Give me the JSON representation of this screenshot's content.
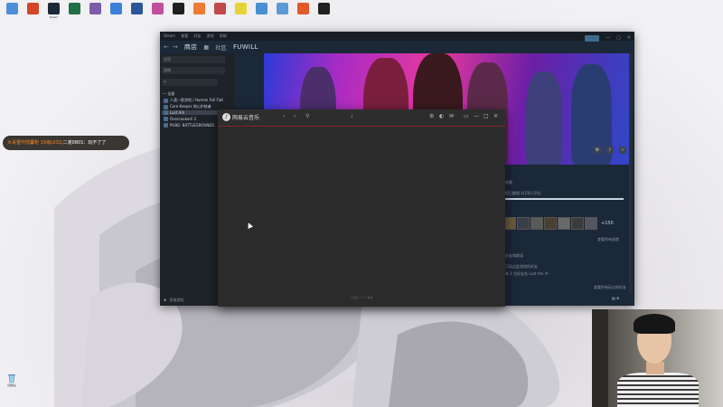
{
  "desktop": {
    "icons": [
      {
        "label": "",
        "icon": "pc-icon",
        "color": "#4d8fd6"
      },
      {
        "label": "",
        "icon": "ppt-icon",
        "color": "#d24726"
      },
      {
        "label": "Steam",
        "icon": "steam-icon",
        "color": "#1b2838"
      },
      {
        "label": "",
        "icon": "excel-icon",
        "color": "#1e7145"
      },
      {
        "label": "",
        "icon": "app-icon",
        "color": "#7a5ca8"
      },
      {
        "label": "",
        "icon": "chat-icon",
        "color": "#3a7fd8"
      },
      {
        "label": "",
        "icon": "word-icon",
        "color": "#2b579a"
      },
      {
        "label": "",
        "icon": "app-icon",
        "color": "#c14f9c"
      },
      {
        "label": "",
        "icon": "app-icon",
        "color": "#202020"
      },
      {
        "label": "",
        "icon": "app-icon",
        "color": "#f07a32"
      },
      {
        "label": "",
        "icon": "app-icon",
        "color": "#c04a4a"
      },
      {
        "label": "",
        "icon": "app-icon",
        "color": "#e6d436"
      },
      {
        "label": "",
        "icon": "app-icon",
        "color": "#4a8fd4"
      },
      {
        "label": "",
        "icon": "app-icon",
        "color": "#5a9bd5"
      },
      {
        "label": "",
        "icon": "app-icon",
        "color": "#e05a2a"
      },
      {
        "label": "",
        "icon": "app-icon",
        "color": "#222222"
      }
    ],
    "recycle_bin": "回收站"
  },
  "danmaku": {
    "prefix": "大哥晋升陆馨粉 15级LV31|",
    "text": "二弟0801：玩不了了"
  },
  "steam": {
    "menu": [
      "Steam",
      "查看",
      "好友",
      "游戏",
      "帮助"
    ],
    "nav": {
      "store": "商店",
      "community": "社区",
      "user": "FUWILL"
    },
    "sidebar": {
      "home": "主页",
      "filter": "游戏",
      "section": "— 全部",
      "games": [
        "人类一败涂地 / Human Fall Flat",
        "Core Keeper 地心护核者",
        "Lost Ark",
        "Overcooked! 2",
        "PUBG: BATTLEGROUNDS"
      ],
      "footer": "添加游戏"
    },
    "right": {
      "section1": "成就",
      "progress_text": "您已解锁 4/156 (3%)",
      "more": "+150",
      "view_all": "查看所有成就",
      "section2": "好友和群组",
      "friend1": "已玩过此游戏的好友",
      "friend2": "有 1 位好友在 Lost Ark 中",
      "friend_link": "查看所有玩过的好友"
    }
  },
  "ncm": {
    "title": "网易云音乐",
    "footer": "工具栏 / 1.7 / 版本"
  }
}
